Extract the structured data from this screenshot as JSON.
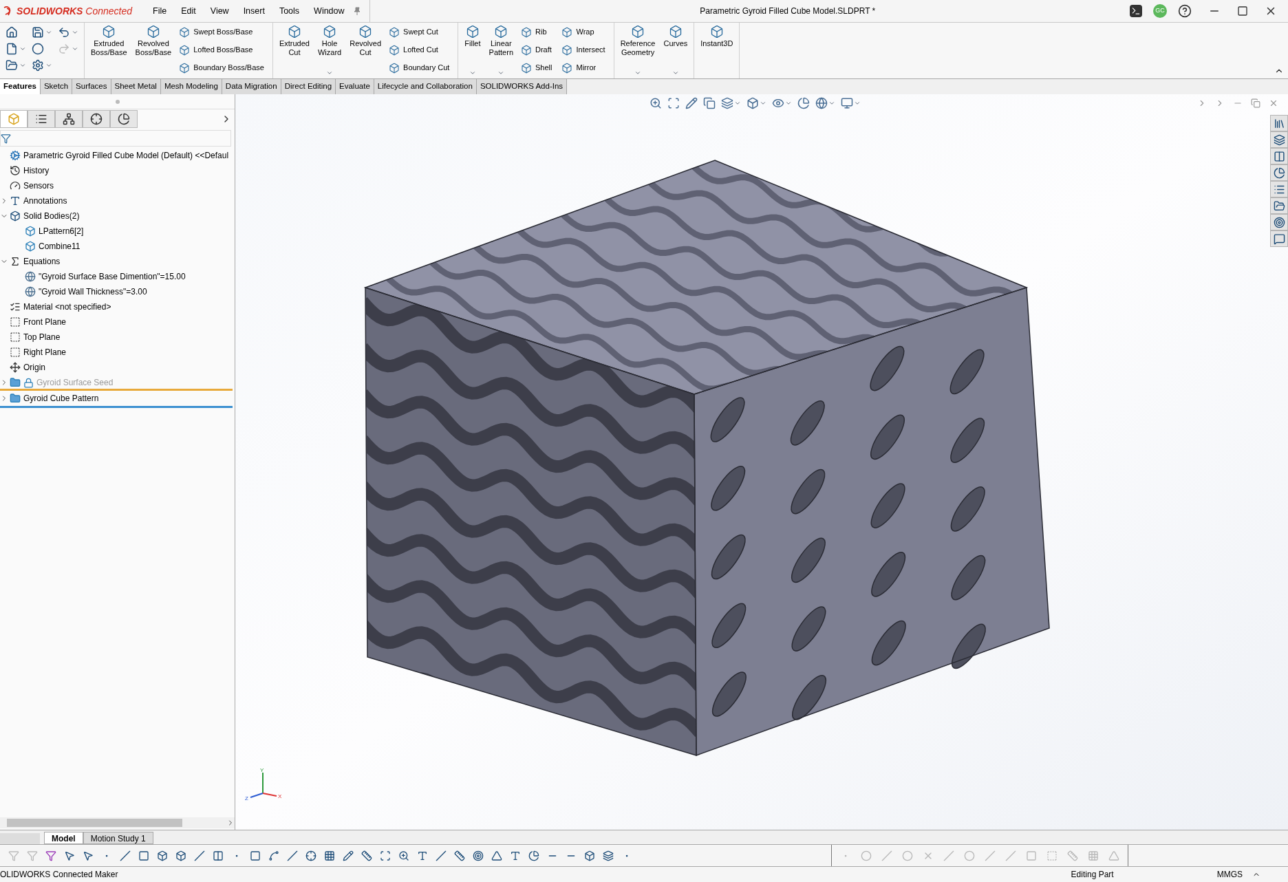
{
  "title_bar": {
    "brand": "**SOLIDWORKS** Connected",
    "menu": [
      "File",
      "Edit",
      "View",
      "Insert",
      "Tools",
      "Window"
    ],
    "document_title": "Parametric Gyroid Filled Cube Model.SLDPRT *",
    "avatar": "GC"
  },
  "ribbon": {
    "groups": [
      {
        "large": [
          {
            "label": "Extruded\nBoss/Base",
            "menu": false
          },
          {
            "label": "Revolved\nBoss/Base",
            "menu": false
          }
        ],
        "small_columns": [
          [
            "Swept Boss/Base",
            "Lofted Boss/Base",
            "Boundary Boss/Base"
          ]
        ]
      },
      {
        "large": [
          {
            "label": "Extruded\nCut",
            "menu": false
          },
          {
            "label": "Hole\nWizard",
            "menu": true
          },
          {
            "label": "Revolved\nCut",
            "menu": false
          }
        ],
        "small_columns": [
          [
            "Swept Cut",
            "Lofted Cut",
            "Boundary Cut"
          ]
        ]
      },
      {
        "large": [
          {
            "label": "Fillet",
            "menu": true
          },
          {
            "label": "Linear\nPattern",
            "menu": true
          }
        ],
        "small_columns": [
          [
            "Rib",
            "Draft",
            "Shell"
          ],
          [
            "Wrap",
            "Intersect",
            "Mirror"
          ]
        ]
      },
      {
        "large": [
          {
            "label": "Reference\nGeometry",
            "menu": true
          },
          {
            "label": "Curves",
            "menu": true
          }
        ]
      },
      {
        "large": [
          {
            "label": "Instant3D",
            "menu": false
          }
        ]
      }
    ]
  },
  "command_tabs": [
    {
      "label": "Features",
      "selected": true
    },
    {
      "label": "Sketch",
      "selected": false
    },
    {
      "label": "Surfaces",
      "selected": false
    },
    {
      "label": "Sheet Metal",
      "selected": false
    },
    {
      "label": "Mesh Modeling",
      "selected": false
    },
    {
      "label": "Data Migration",
      "selected": false
    },
    {
      "label": "Direct Editing",
      "selected": false
    },
    {
      "label": "Evaluate",
      "selected": false
    },
    {
      "label": "Lifecycle and Collaboration",
      "selected": false
    },
    {
      "label": "SOLIDWORKS Add-Ins",
      "selected": false
    }
  ],
  "feature_tree": {
    "items": [
      {
        "label": "Parametric Gyroid Filled Cube Model (Default) <<Defaul",
        "kind": "part"
      },
      {
        "label": "History",
        "kind": "history"
      },
      {
        "label": "Sensors",
        "kind": "sensors"
      },
      {
        "label": "Annotations",
        "kind": "annotations",
        "expanded": false
      },
      {
        "label": "Solid Bodies(2)",
        "kind": "bodies",
        "expanded": true,
        "children": [
          {
            "label": "LPattern6[2]",
            "kind": "body"
          },
          {
            "label": "Combine11",
            "kind": "body"
          }
        ]
      },
      {
        "label": "Equations",
        "kind": "equations",
        "expanded": true,
        "children": [
          {
            "label": "\"Gyroid Surface Base Dimention\"=15.00",
            "kind": "equation"
          },
          {
            "label": "\"Gyroid Wall Thickness\"=3.00",
            "kind": "equation"
          }
        ]
      },
      {
        "label": "Material <not specified>",
        "kind": "material"
      },
      {
        "label": "Front Plane",
        "kind": "plane"
      },
      {
        "label": "Top Plane",
        "kind": "plane"
      },
      {
        "label": "Right Plane",
        "kind": "plane"
      },
      {
        "label": "Origin",
        "kind": "origin"
      },
      {
        "label": "Gyroid Surface Seed",
        "kind": "folder",
        "expanded": false,
        "locked": true,
        "suppressed": true
      },
      {
        "label": "Gyroid Cube Pattern",
        "kind": "folder",
        "expanded": false,
        "locked": false,
        "suppressed": false
      }
    ]
  },
  "panel_tabs": [
    {
      "selected": true
    },
    {
      "selected": false
    },
    {
      "selected": false
    },
    {
      "selected": false
    },
    {
      "selected": false
    }
  ],
  "triad": {
    "y": "Y",
    "z": "Z",
    "x": "X"
  },
  "model_tabs": [
    {
      "label": "Model",
      "selected": true
    },
    {
      "label": "Motion Study 1",
      "selected": false
    }
  ],
  "status_bar": {
    "left": "OLIDWORKS Connected Maker",
    "mode": "Editing Part",
    "units": "MMGS"
  }
}
